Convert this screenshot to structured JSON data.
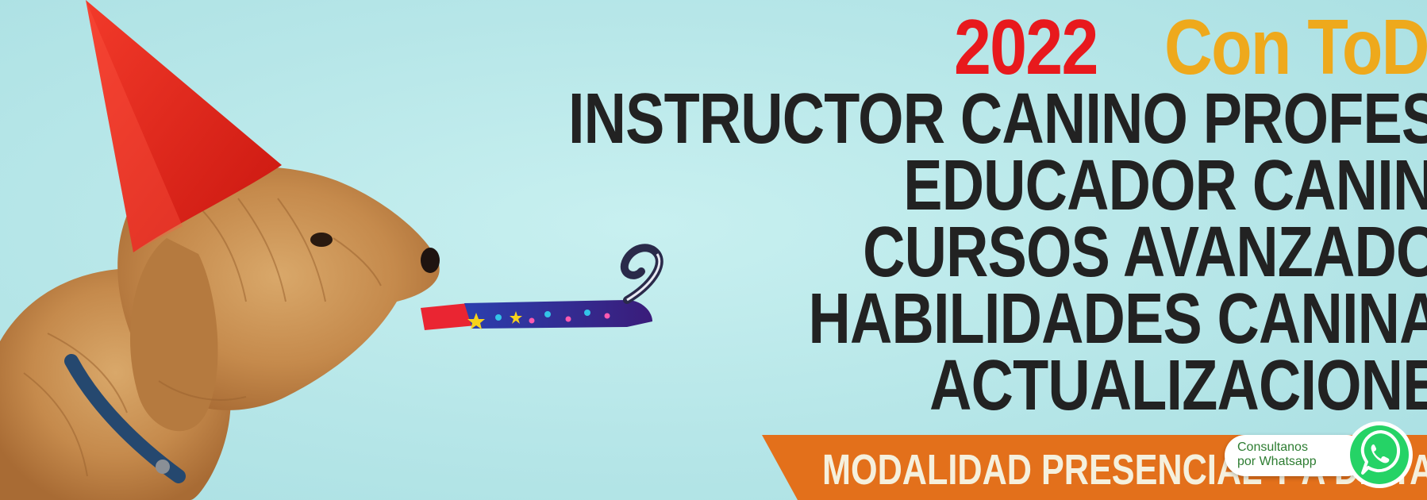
{
  "banner": {
    "year": "2022",
    "tagline": "Con ToDo",
    "courses": [
      "INSTRUCTOR CANINO PROFESIONAL",
      "EDUCADOR CANINO",
      "CURSOS AVANZADOS",
      "HABILIDADES CANINAS",
      "ACTUALIZACIONES"
    ],
    "modality": "MODALIDAD PRESENCIAL Y A DISTANCIA",
    "colors": {
      "background": "#b9e8ea",
      "year": "#e8191d",
      "tagline": "#eea91c",
      "courses": "#222222",
      "modality_bar": "#e3701b"
    }
  },
  "whatsapp": {
    "line1": "Consultanos",
    "line2": "por Whatsapp",
    "icon": "whatsapp-icon",
    "color": "#25d366"
  }
}
